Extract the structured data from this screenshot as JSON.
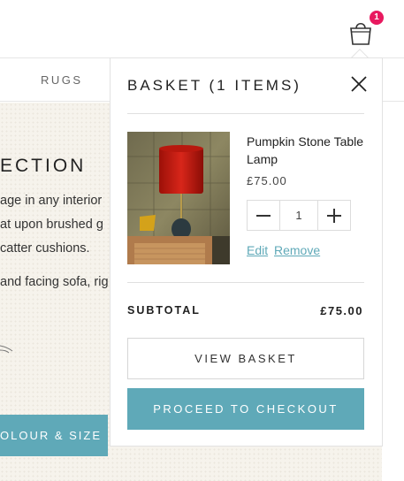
{
  "header": {
    "basket_count": "1"
  },
  "nav": {
    "items": [
      {
        "label": "RUGS"
      }
    ]
  },
  "background": {
    "collection_title": "ECTION",
    "lines": [
      "age in any interior",
      "at upon brushed g",
      "catter cushions.",
      "and facing sofa, rig"
    ],
    "colour_button": "OLOUR & SIZE"
  },
  "basket": {
    "title": "BASKET (1 ITEMS)",
    "item": {
      "name": "Pumpkin Stone Table Lamp",
      "price": "£75.00",
      "quantity": "1",
      "edit_label": "Edit",
      "remove_label": "Remove"
    },
    "subtotal_label": "SUBTOTAL",
    "subtotal_value": "£75.00",
    "view_basket_label": "VIEW BASKET",
    "checkout_label": "PROCEED TO CHECKOUT"
  },
  "colors": {
    "accent": "#5fa9b8",
    "badge": "#e8195f"
  }
}
